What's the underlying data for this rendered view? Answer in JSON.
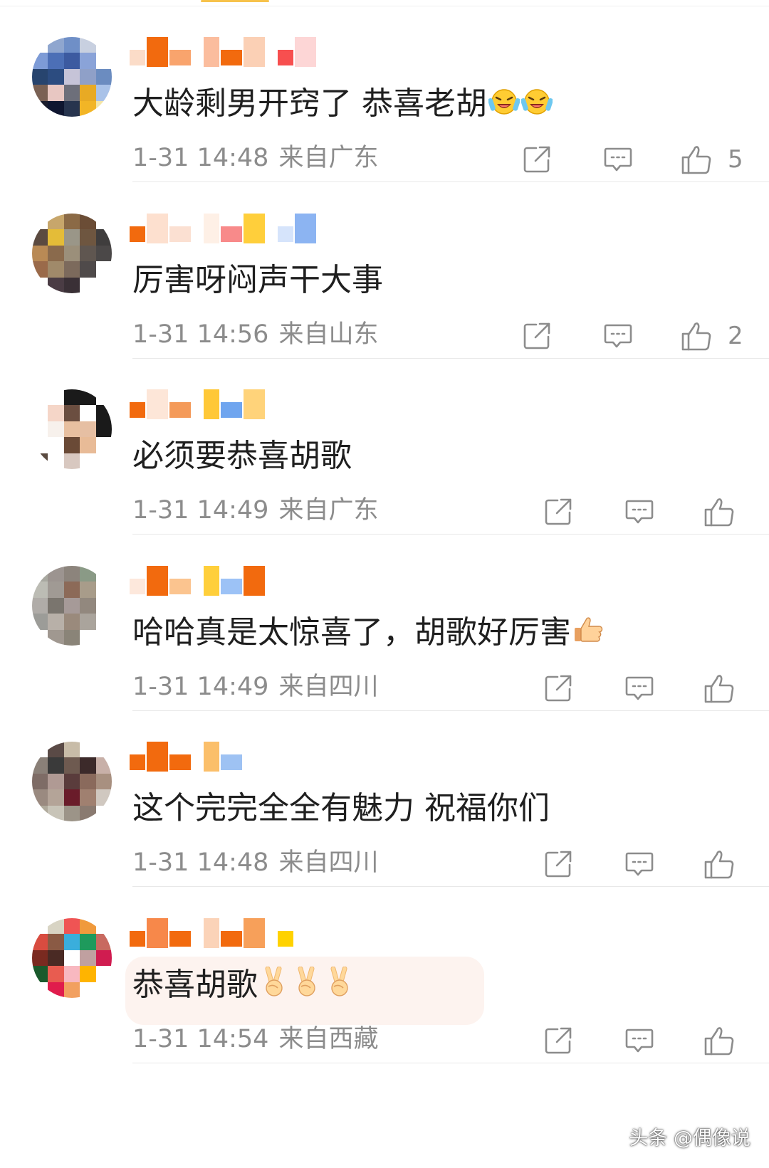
{
  "comments": [
    {
      "text": "大龄剩男开窍了 恭喜老胡",
      "text_emojis": [
        "crying-laugh-emoji",
        "crying-laugh-emoji"
      ],
      "time": "1-31 14:48",
      "location": "来自广东",
      "likes": "5",
      "avatar_colors": [
        "#ffffff",
        "#8fa6cf",
        "#6f8fc7",
        "#c8d0e0",
        "#ffffff",
        "#7d9bd6",
        "#4c6fb6",
        "#3c5aa0",
        "#8aa3d8",
        "#ffffff",
        "#27446e",
        "#2c4c80",
        "#c6c4d8",
        "#8fa0c8",
        "#6b8cc0",
        "#7a6154",
        "#e8c7c2",
        "#6d6f7a",
        "#e8aa24",
        "#a9c2e8",
        "#1a1c2c",
        "#0f1630",
        "#27344e",
        "#f2b526",
        "#f3e5a8"
      ],
      "name_colors": [
        "#fbdcc8",
        "#f26a0e",
        "#f9a46d",
        "#fbbd9e",
        "#f26a0e",
        "#fbd0b5",
        "#f74f4f",
        "#fdd6d6"
      ]
    },
    {
      "text": "厉害呀闷声干大事",
      "text_emojis": [],
      "time": "1-31 14:56",
      "location": "来自山东",
      "likes": "2",
      "avatar_colors": [
        "#ffffff",
        "#c7a66b",
        "#8b6a46",
        "#6b4d36",
        "#ffffff",
        "#5b4a40",
        "#e4bc38",
        "#9a9688",
        "#6e5640",
        "#3f3d3d",
        "#b98a55",
        "#8a6a4c",
        "#9b8f7a",
        "#5f5650",
        "#4b4848",
        "#9a6a4a",
        "#a08a6a",
        "#7c6a5c",
        "#4f4a4a",
        "#ffffff",
        "#ffffff",
        "#4a3c44",
        "#3a3036",
        "#ffffff",
        "#ffffff"
      ],
      "name_colors": [
        "#f26a0e",
        "#fde0cf",
        "#fbe0d2",
        "#fef0e6",
        "#f88a8a",
        "#ffcf3b",
        "#d6e4fb",
        "#8cb4f2"
      ]
    },
    {
      "text": "必须要恭喜胡歌",
      "text_emojis": [],
      "time": "1-31 14:49",
      "location": "来自广东",
      "likes": "",
      "avatar_colors": [
        "#ffffff",
        "#ffffff",
        "#1a1a1a",
        "#1a1a1a",
        "#ffffff",
        "#ffffff",
        "#f5d6c8",
        "#6b4e40",
        "#ffffff",
        "#1a1a1a",
        "#ffffff",
        "#f7f1ec",
        "#e8c0a0",
        "#e6bfa3",
        "#1a1a1a",
        "#ffffff",
        "#ffffff",
        "#6a4a36",
        "#e8bb97",
        "#ffffff",
        "#5a4a40",
        "#ffffff",
        "#d8c8c0",
        "#ffffff",
        "#ffffff"
      ],
      "name_colors": [
        "#f26a0e",
        "#fde6d8",
        "#f49a59",
        "#ffc837",
        "#6fa5ef",
        "#ffd37a"
      ]
    },
    {
      "text": "哈哈真是太惊喜了，胡歌好厉害",
      "text_emojis": [
        "thumbs-up-emoji"
      ],
      "time": "1-31 14:49",
      "location": "来自四川",
      "likes": "",
      "avatar_colors": [
        "#a8a8a0",
        "#9c9490",
        "#8c847c",
        "#8a9a86",
        "#ffffff",
        "#bcbcb4",
        "#a09a94",
        "#8c6a58",
        "#a89c8a",
        "#ffffff",
        "#b0aca8",
        "#7a756e",
        "#a69a98",
        "#92887e",
        "#ffffff",
        "#9c9c98",
        "#b8b0a8",
        "#9a8a7c",
        "#aaa49c",
        "#ffffff",
        "#ffffff",
        "#a09890",
        "#8a8478",
        "#ffffff",
        "#ffffff"
      ],
      "name_colors": [
        "#fde8dc",
        "#f26a0e",
        "#fbc48f",
        "#ffcf3b",
        "#9cc2f6",
        "#f26a0e"
      ]
    },
    {
      "text": "这个完完全全有魅力 祝福你们",
      "text_emojis": [],
      "time": "1-31 14:48",
      "location": "来自四川",
      "likes": "",
      "avatar_colors": [
        "#ffffff",
        "#5a4a46",
        "#c8bca8",
        "#ffffff",
        "#ffffff",
        "#8a8078",
        "#3a3a3a",
        "#6e5a50",
        "#3c2a2a",
        "#c8b0a8",
        "#7e6c66",
        "#b09a94",
        "#5a3c3c",
        "#8a6a5c",
        "#a89080",
        "#9a8a80",
        "#b4a498",
        "#6a1c2a",
        "#a08070",
        "#d0c8c0",
        "#b0aa9c",
        "#c8c4b8",
        "#9c9488",
        "#8a7a70",
        "#ffffff"
      ],
      "name_colors": [
        "#f26a0e",
        "#f26a0e",
        "#f26a0e",
        "#fbbf6a",
        "#9ec2f3"
      ]
    },
    {
      "text": "恭喜胡歌",
      "text_emojis": [
        "victory-hand-emoji",
        "victory-hand-emoji",
        "victory-hand-emoji"
      ],
      "time": "1-31 14:54",
      "location": "来自西藏",
      "likes": "",
      "avatar_colors": [
        "#ffffff",
        "#d8d4c4",
        "#ef5454",
        "#f09a3c",
        "#ffffff",
        "#d84c40",
        "#8a5a44",
        "#3aaedc",
        "#1e9a5c",
        "#c86a60",
        "#7a2a20",
        "#4a2a24",
        "#ffffff",
        "#c0a0a0",
        "#d01c50",
        "#1a5a2c",
        "#e85c50",
        "#f8b8c0",
        "#ffb400",
        "#ffffff",
        "#ffffff",
        "#e01c4c",
        "#f2a060",
        "#ffffff",
        "#ffffff"
      ],
      "name_colors": [
        "#f26a0e",
        "#f7884a",
        "#f26a0e",
        "#fbd3b8",
        "#f26a0e",
        "#f7a05a",
        "#ffd200"
      ]
    }
  ],
  "watermark": "头条 @偶像说"
}
